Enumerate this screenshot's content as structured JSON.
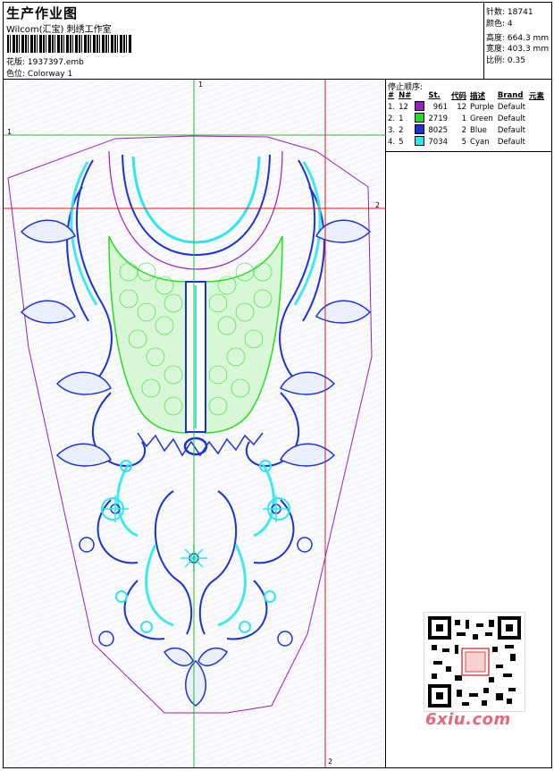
{
  "header": {
    "title": "生产作业图",
    "subtitle": "Wilcom(汇宝) 刺绣工作室",
    "design_label": "花版:",
    "design_file": "1937397.emb",
    "colorway_label": "色位:",
    "colorway": "Colorway 1"
  },
  "stats": [
    {
      "label": "针数:",
      "value": "18741"
    },
    {
      "label": "颜色:",
      "value": "4"
    },
    {
      "label": "高度:",
      "value": "664.3 mm"
    },
    {
      "label": "宽度:",
      "value": "403.3 mm"
    },
    {
      "label": "比例:",
      "value": "0.35"
    }
  ],
  "stop_sequence": {
    "title": "停止顺序:",
    "columns": [
      "#",
      "N#",
      "St.",
      "代码",
      "描述",
      "Brand",
      "元素"
    ],
    "rows": [
      {
        "idx": "1.",
        "n": "12",
        "color": "#9b1fbf",
        "st": "961",
        "code": "12",
        "desc": "Purple",
        "brand": "Default"
      },
      {
        "idx": "2.",
        "n": "1",
        "color": "#22e01c",
        "st": "2719",
        "code": "1",
        "desc": "Green",
        "brand": "Default"
      },
      {
        "idx": "3.",
        "n": "2",
        "color": "#1a32d8",
        "st": "8025",
        "code": "2",
        "desc": "Blue",
        "brand": "Default"
      },
      {
        "idx": "4.",
        "n": "5",
        "color": "#2ee6ee",
        "st": "7034",
        "code": "5",
        "desc": "Cyan",
        "brand": "Default"
      }
    ]
  },
  "guides": {
    "v1": "1",
    "h1": "1",
    "h2": "2",
    "v2": "2"
  },
  "colors": {
    "purple": "#9b1fbf",
    "green": "#22e01c",
    "blue": "#1a32d8",
    "cyan": "#2ee6ee",
    "guide_red": "#e01a1a",
    "guide_green": "#22c022"
  },
  "watermark": {
    "text": "6xiu.com",
    "icon": "qr-code-icon"
  }
}
